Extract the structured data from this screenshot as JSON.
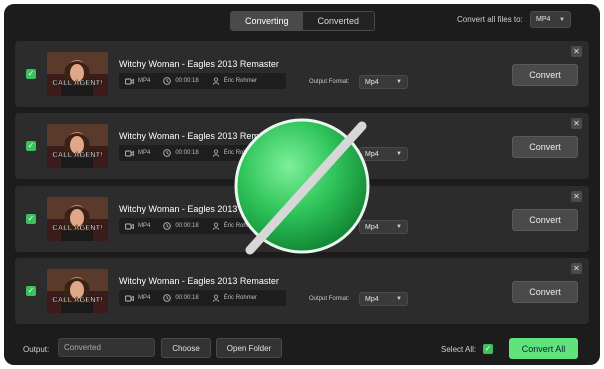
{
  "tabs": [
    {
      "label": "Converting",
      "active": true
    },
    {
      "label": "Converted",
      "active": false
    }
  ],
  "convert_all_files": {
    "label": "Convert all files to:",
    "value": "MP4"
  },
  "rows": [
    {
      "title": "Witchy Woman - Eagles 2013 Remaster",
      "format": "MP4",
      "duration": "00:00:18",
      "artist": "Éric Rohmer",
      "output_format_label": "Output Format:",
      "output_format": "Mp4",
      "convert_label": "Convert",
      "thumb_text": "CALL AGENT!"
    },
    {
      "title": "Witchy Woman - Eagles 2013 Remaster",
      "format": "MP4",
      "duration": "00:00:18",
      "artist": "Éric Rohmer",
      "output_format_label": "Output Format:",
      "output_format": "Mp4",
      "convert_label": "Convert",
      "thumb_text": "CALL AGENT!"
    },
    {
      "title": "Witchy Woman - Eagles 2013 Remaster",
      "format": "MP4",
      "duration": "00:00:18",
      "artist": "Éric Rohmer",
      "output_format_label": "Output Format:",
      "output_format": "Mp4",
      "convert_label": "Convert",
      "thumb_text": "CALL AGENT!"
    },
    {
      "title": "Witchy Woman - Eagles 2013 Remaster",
      "format": "MP4",
      "duration": "00:00:18",
      "artist": "Éric Rohmer",
      "output_format_label": "Output Format:",
      "output_format": "Mp4",
      "convert_label": "Convert",
      "thumb_text": "CALL AGENT!"
    }
  ],
  "bottom": {
    "output_label": "Output:",
    "output_value": "Converted",
    "choose_label": "Choose",
    "open_folder_label": "Open Folder",
    "select_all_label": "Select All:",
    "convert_all_label": "Convert All"
  },
  "colors": {
    "accent": "#5fe37a",
    "checkbox": "#3cc15f",
    "background": "#1c1c1c",
    "card": "#2c2c2c"
  },
  "icons": {
    "row_check": "checkmark-icon",
    "close": "close-icon",
    "video": "video-icon",
    "clock": "clock-icon",
    "person": "person-icon",
    "overlay": "prohibited-icon"
  }
}
